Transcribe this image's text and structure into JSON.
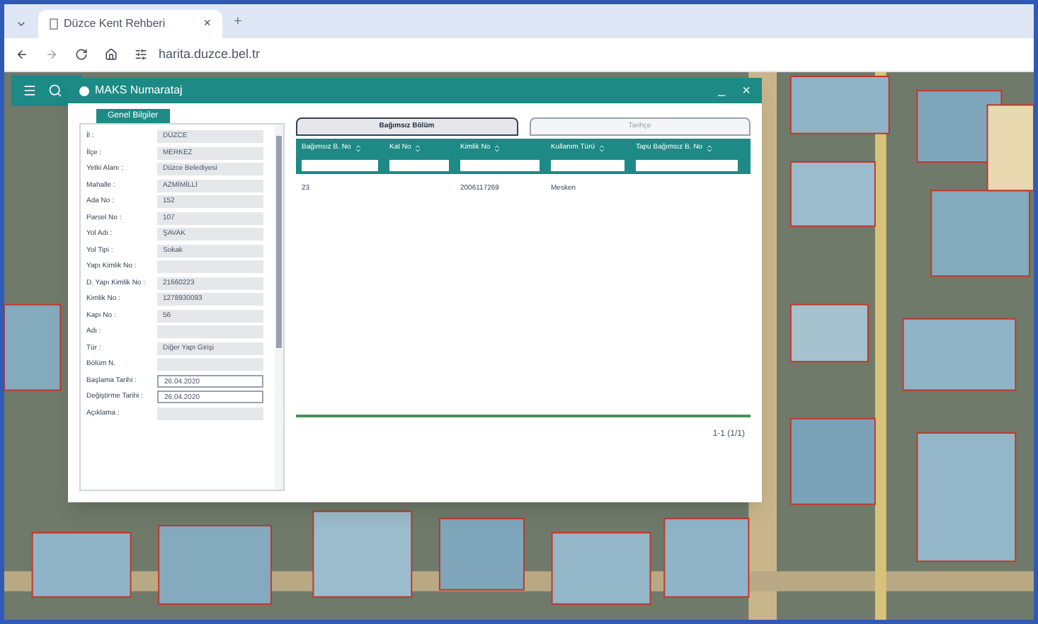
{
  "browser": {
    "tab_title": "Düzce Kent Rehberi",
    "tab_close": "×",
    "new_tab": "+",
    "address": "harita.duzce.bel.tr"
  },
  "dialog": {
    "title": "MAKS Numarataj",
    "minimize": "_",
    "close": "×"
  },
  "info_panel": {
    "button": "Genel Bilgiler",
    "fields": [
      {
        "label": "İl :",
        "value": "DÜZCE",
        "editable": false
      },
      {
        "label": "İlçe :",
        "value": "MERKEZ",
        "editable": false
      },
      {
        "label": "Yetki Alanı :",
        "value": "Düzce Belediyesi",
        "editable": false
      },
      {
        "label": "Mahalle :",
        "value": "AZMİMİLLİ",
        "editable": false
      },
      {
        "label": "Ada No :",
        "value": "152",
        "editable": false
      },
      {
        "label": "Parsel No :",
        "value": "107",
        "editable": false
      },
      {
        "label": "Yol Adı :",
        "value": "ŞAVAK",
        "editable": false
      },
      {
        "label": "Yol Tipi :",
        "value": "Sokak",
        "editable": false
      },
      {
        "label": "Yapı Kimlik No :",
        "editable": false
      },
      {
        "label": "D. Yapı Kimlik No :",
        "value": "21660223",
        "editable": false
      },
      {
        "label": "Kimlik No :",
        "value": "1278930093",
        "editable": false
      },
      {
        "label": "Kapı No :",
        "value": "56",
        "editable": false
      },
      {
        "label": "Adı :",
        "editable": false
      },
      {
        "label": "Tür :",
        "value": "Diğer Yapı Girişi",
        "editable": false
      },
      {
        "label": "Bölüm N.",
        "editable": false
      },
      {
        "label": "Başlama Tarihi :",
        "value": "26.04.2020",
        "editable": true
      },
      {
        "label": "Değiştirme Tarihi :",
        "value": "26.04.2020",
        "editable": true
      },
      {
        "label": "Açıklama :",
        "editable": false
      }
    ]
  },
  "tabs": [
    {
      "label": "Bağımsız Bölüm",
      "selected": true
    },
    {
      "label": "Tarihçe",
      "selected": false
    }
  ],
  "table": {
    "columns": [
      "Bağımsız B. No",
      "Kat No",
      "Kimlik No",
      "Kullanım Türü",
      "Tapu Bağımsız B. No"
    ],
    "rows": [
      [
        "23",
        "",
        "2006117269",
        "Mesken",
        ""
      ]
    ],
    "pager": "1-1 (1/1)"
  }
}
